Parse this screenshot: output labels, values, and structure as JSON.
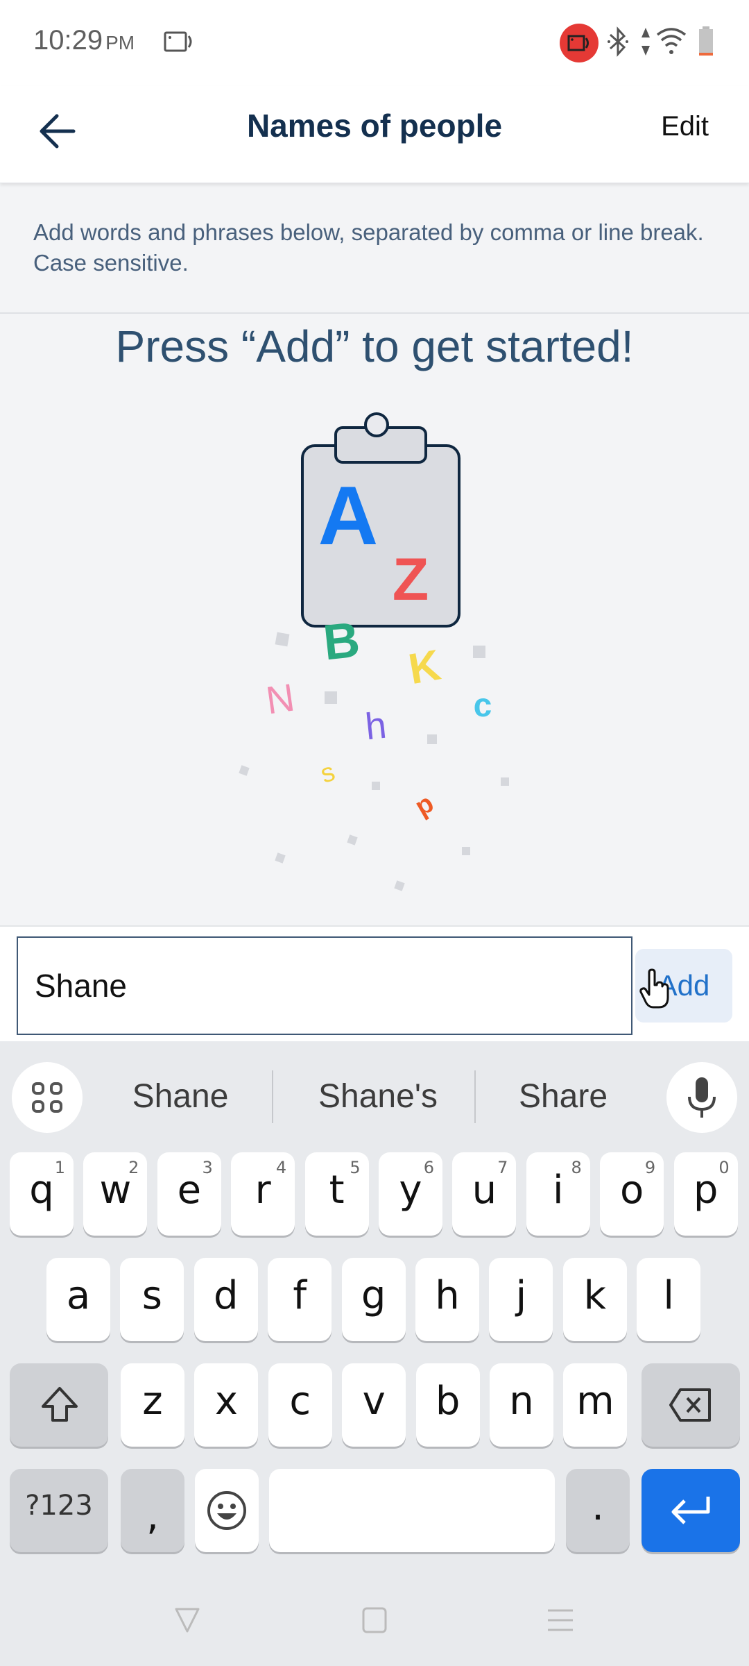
{
  "status_bar": {
    "time": "10:29",
    "ampm": "PM",
    "icons": [
      "screen-record-icon",
      "camera-recording-icon",
      "bluetooth-icon",
      "data-arrows-icon",
      "wifi-icon",
      "battery-icon"
    ],
    "record_color": "#e53935"
  },
  "app_bar": {
    "title": "Names of people",
    "back_icon": "arrow-left-icon",
    "edit_label": "Edit"
  },
  "hint": {
    "text": "Add words and phrases below, separated by comma or line break. Case sensitive."
  },
  "empty_state": {
    "title": "Press “Add” to get started!",
    "illustration": {
      "icon": "clipboard-icon",
      "letters": [
        {
          "char": "A",
          "color": "#1479f2"
        },
        {
          "char": "Z",
          "color": "#ef5454"
        },
        {
          "char": "B",
          "color": "#2aa97f"
        },
        {
          "char": "K",
          "color": "#f6d94d"
        },
        {
          "char": "N",
          "color": "#f28fb3"
        },
        {
          "char": "h",
          "color": "#7b62e3"
        },
        {
          "char": "c",
          "color": "#48c6ea"
        },
        {
          "char": "s",
          "color": "#f4d23e"
        },
        {
          "char": "p",
          "color": "#ee5a24"
        }
      ]
    }
  },
  "input": {
    "value": "Shane",
    "add_label": "Add",
    "accent": "#2171c9"
  },
  "keyboard": {
    "suggestions": [
      "Shane",
      "Shane's",
      "Share"
    ],
    "row1": [
      {
        "k": "q",
        "n": "1"
      },
      {
        "k": "w",
        "n": "2"
      },
      {
        "k": "e",
        "n": "3"
      },
      {
        "k": "r",
        "n": "4"
      },
      {
        "k": "t",
        "n": "5"
      },
      {
        "k": "y",
        "n": "6"
      },
      {
        "k": "u",
        "n": "7"
      },
      {
        "k": "i",
        "n": "8"
      },
      {
        "k": "o",
        "n": "9"
      },
      {
        "k": "p",
        "n": "0"
      }
    ],
    "row2": [
      "a",
      "s",
      "d",
      "f",
      "g",
      "h",
      "j",
      "k",
      "l"
    ],
    "row3": [
      "z",
      "x",
      "c",
      "v",
      "b",
      "n",
      "m"
    ],
    "symbols_label": "?123",
    "comma": ",",
    "period": ".",
    "enter_color": "#1a73e8"
  },
  "nav_bar": {
    "icons": [
      "back-triangle-icon",
      "home-square-icon",
      "recents-lines-icon"
    ]
  }
}
